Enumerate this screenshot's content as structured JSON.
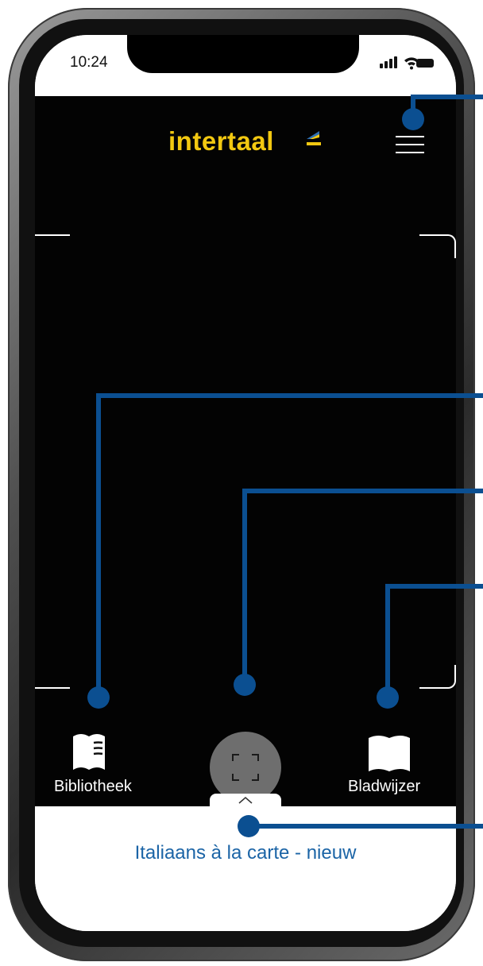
{
  "status_bar": {
    "time": "10:24"
  },
  "header": {
    "logo_text": "intertaal"
  },
  "toolbar": {
    "library_label": "Bibliotheek",
    "bookmark_label": "Bladwijzer"
  },
  "bottom_sheet": {
    "title": "Italiaans à la carte - nieuw"
  },
  "colors": {
    "logo_yellow": "#f2c811",
    "callout_blue": "#0b4f91",
    "link_blue": "#1b64a6",
    "scan_button_gray": "#6e6e6e"
  },
  "icons": [
    "cellular-signal-icon",
    "wifi-icon",
    "battery-icon",
    "hamburger-menu-icon",
    "book-icon",
    "scan-frame-icon",
    "bookmark-icon",
    "chevron-up-icon"
  ]
}
